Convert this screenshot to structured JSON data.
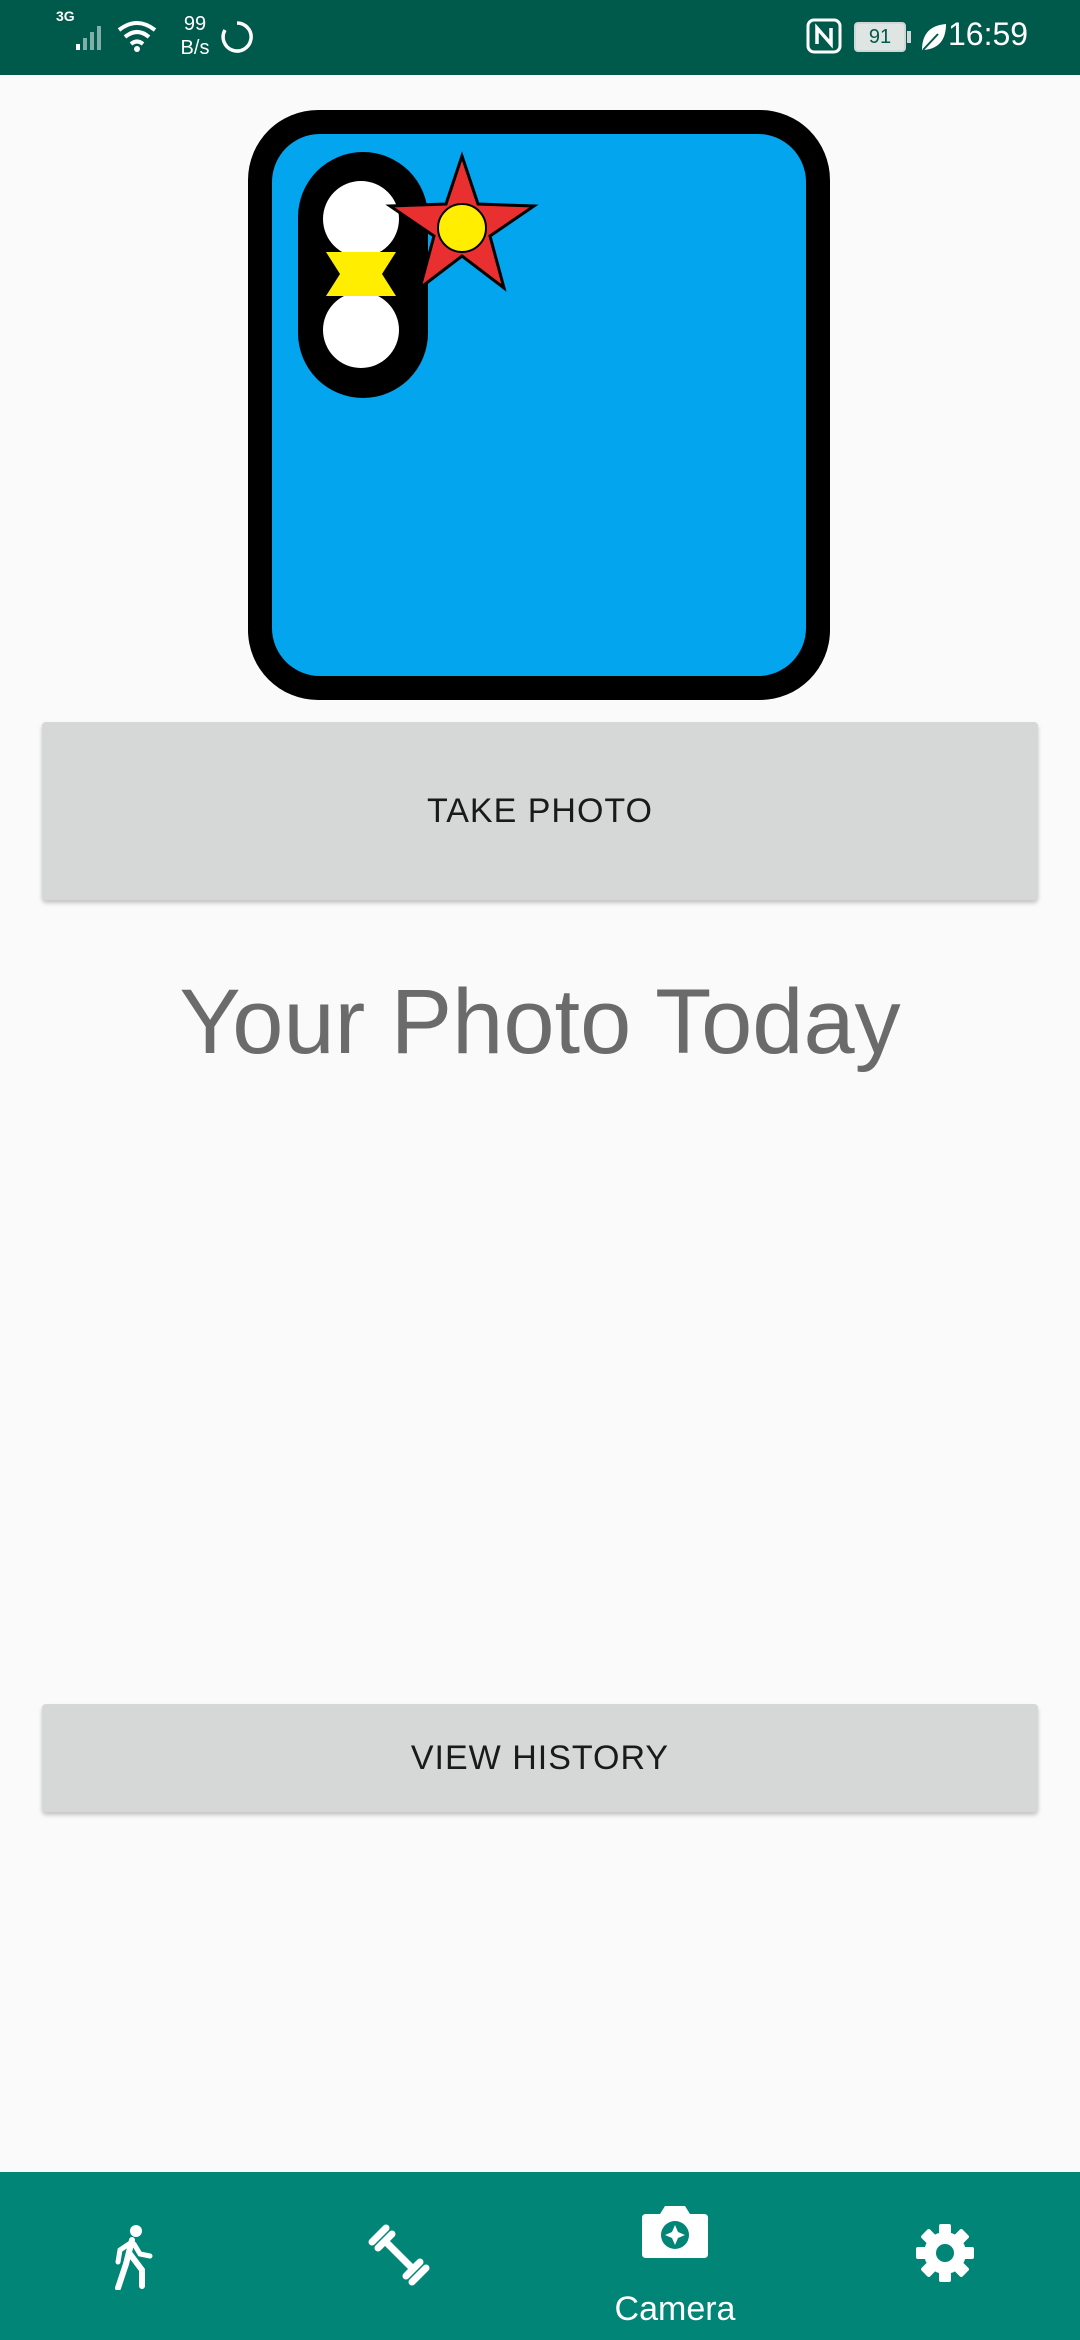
{
  "status_bar": {
    "network_type": "3G",
    "net_speed_value": "99",
    "net_speed_unit": "B/s",
    "battery_level": "91",
    "time": "16:59",
    "icons": [
      "signal-icon",
      "wifi-icon",
      "sync-icon",
      "nfc-icon",
      "battery-icon",
      "leaf-icon"
    ]
  },
  "main": {
    "take_photo_label": "TAKE PHOTO",
    "heading": "Your Photo Today",
    "view_history_label": "VIEW HISTORY"
  },
  "bottom_nav": {
    "items": [
      {
        "icon": "walk-icon",
        "label": ""
      },
      {
        "icon": "dumbbell-icon",
        "label": ""
      },
      {
        "icon": "camera-icon",
        "label": "Camera",
        "selected": true
      },
      {
        "icon": "settings-icon",
        "label": ""
      }
    ]
  },
  "colors": {
    "status_bar": "#005a4b",
    "nav_bar": "#008576",
    "button": "#d6d7d7",
    "phone_screen": "#03a5ee",
    "star": "#e92f2f",
    "star_center": "#ffee00"
  }
}
